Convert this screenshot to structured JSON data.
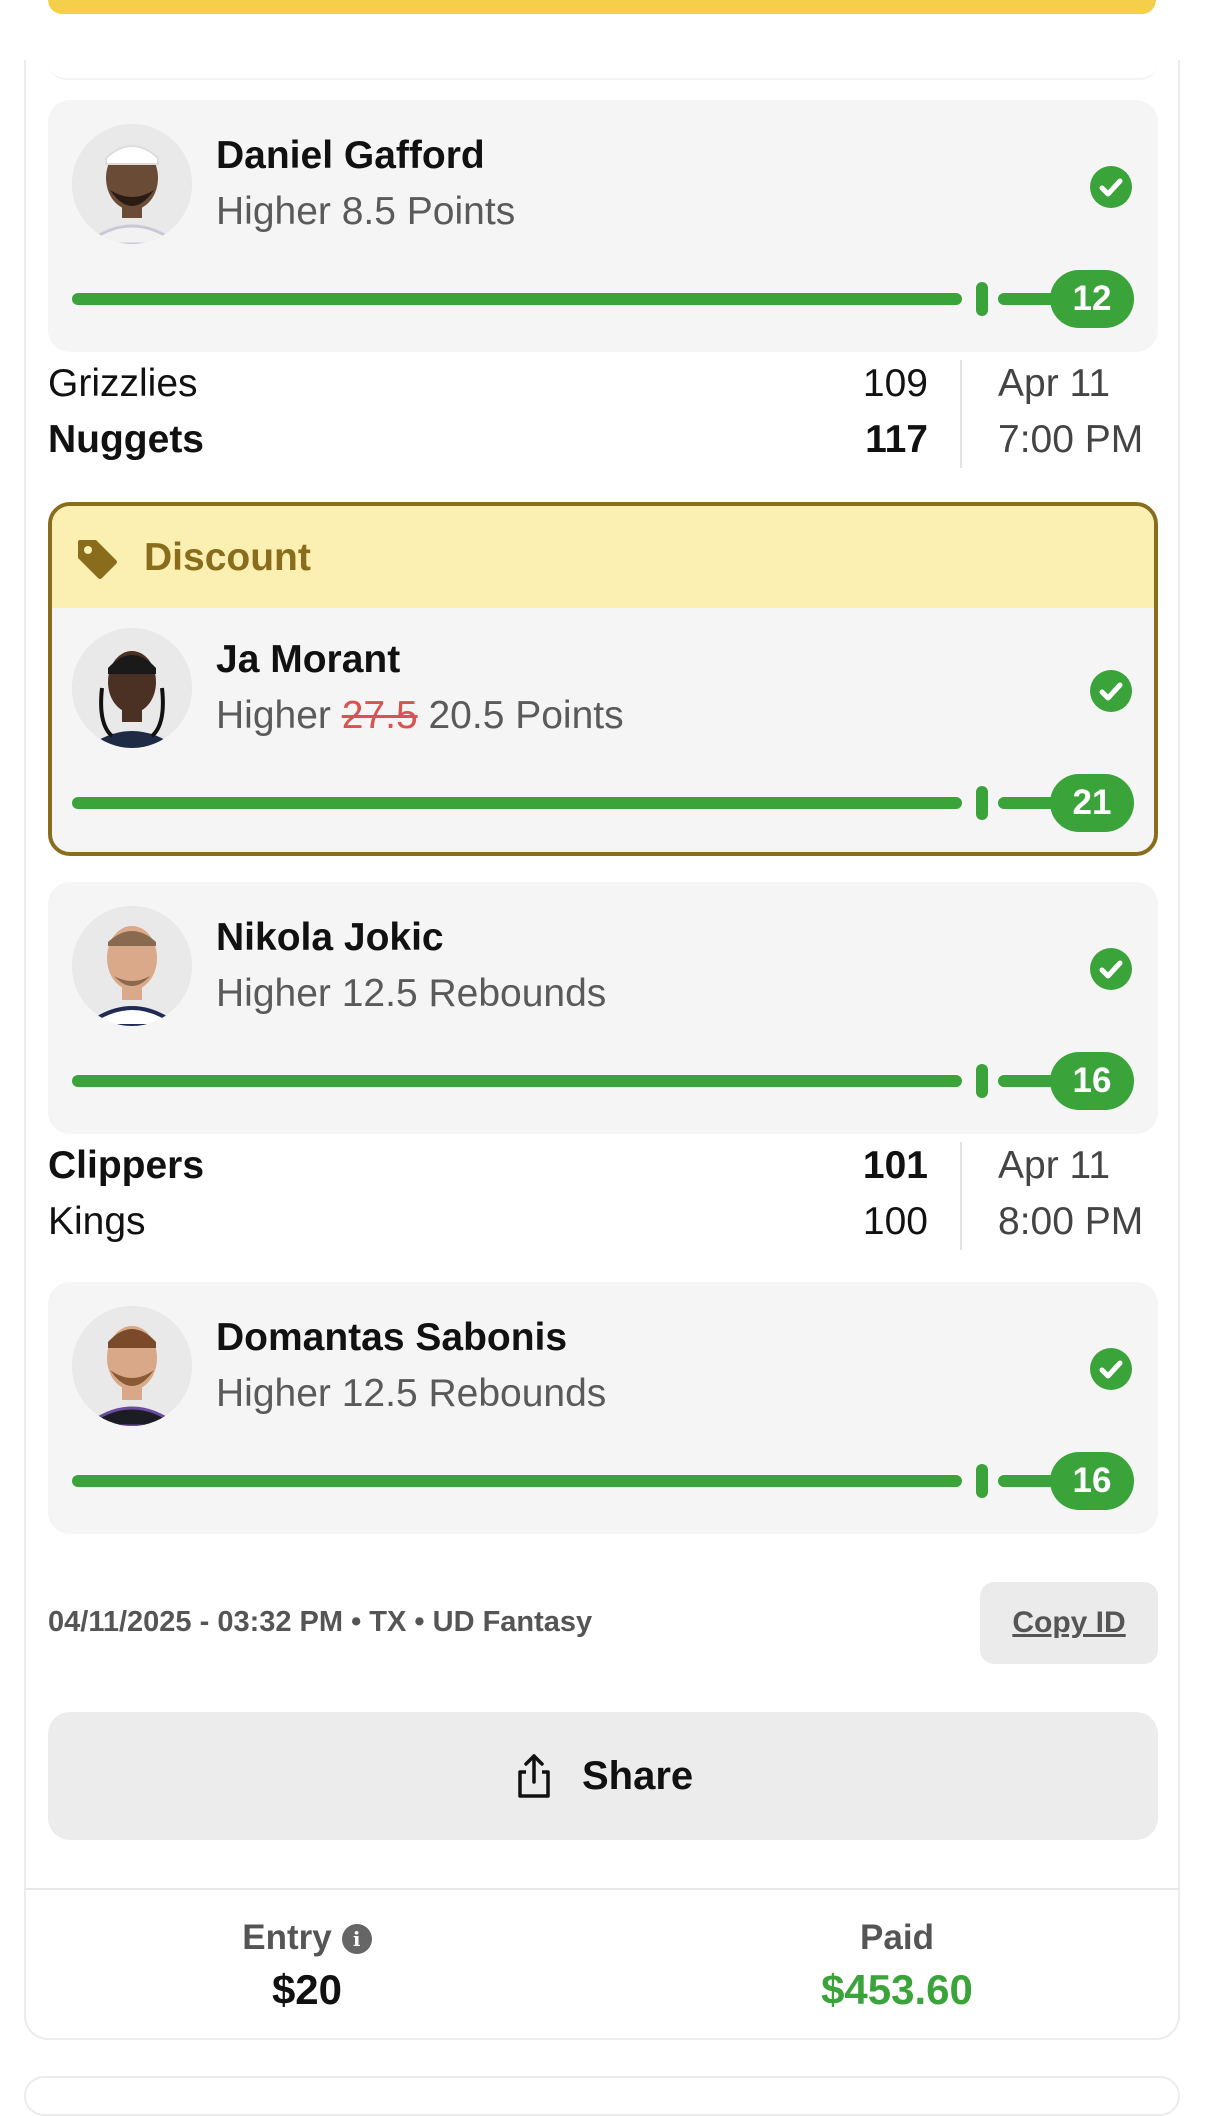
{
  "colors": {
    "accent_green": "#3aa33a",
    "discount_border": "#8a6d1c",
    "discount_bg": "#fbf0b2",
    "strike_red": "#d9534f"
  },
  "picks": [
    {
      "player": "Daniel Gafford",
      "line_prefix": "Higher",
      "line_value": "8.5",
      "stat": "Points",
      "result": "12"
    },
    {
      "player": "Ja Morant",
      "line_prefix": "Higher",
      "original_line": "27.5",
      "line_value": "20.5",
      "stat": "Points",
      "result": "21",
      "discount_label": "Discount"
    },
    {
      "player": "Nikola Jokic",
      "line_prefix": "Higher",
      "line_value": "12.5",
      "stat": "Rebounds",
      "result": "16"
    },
    {
      "player": "Domantas Sabonis",
      "line_prefix": "Higher",
      "line_value": "12.5",
      "stat": "Rebounds",
      "result": "16"
    }
  ],
  "games": [
    {
      "team1": "Grizzlies",
      "score1": "109",
      "team2": "Nuggets",
      "score2": "117",
      "date": "Apr 11",
      "time": "7:00 PM"
    },
    {
      "team1": "Clippers",
      "score1": "101",
      "team2": "Kings",
      "score2": "100",
      "date": "Apr 11",
      "time": "8:00 PM"
    }
  ],
  "meta": "04/11/2025 - 03:32 PM • TX • UD Fantasy",
  "copy_id_label": "Copy ID",
  "share_label": "Share",
  "footer": {
    "entry_label": "Entry",
    "entry_value": "$20",
    "paid_label": "Paid",
    "paid_value": "$453.60"
  },
  "icons": {
    "check": "check-circle-icon",
    "tag": "tag-icon",
    "share": "share-icon",
    "info": "info-icon"
  }
}
